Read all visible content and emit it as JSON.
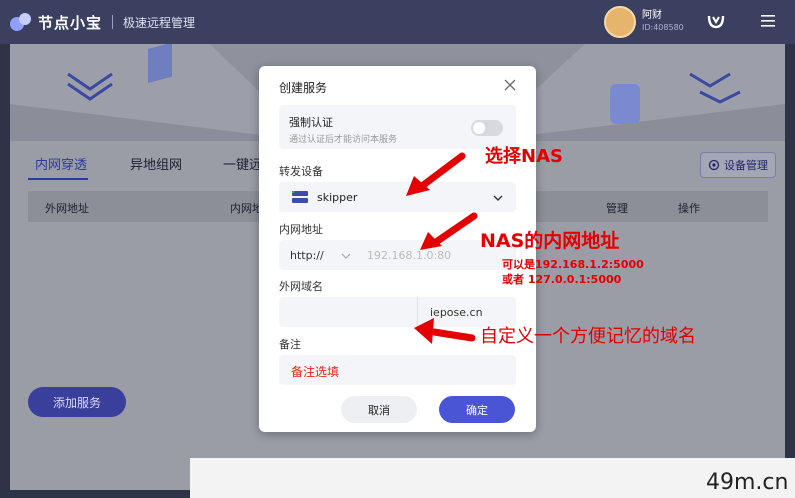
{
  "header": {
    "app_name": "节点小宝",
    "subtitle": "极速远程管理",
    "user_name": "阿财",
    "user_id": "ID:408580"
  },
  "main": {
    "tabs": [
      {
        "label": "内网穿透",
        "active": true
      },
      {
        "label": "异地组网",
        "active": false
      },
      {
        "label": "一键远"
      }
    ],
    "device_manage_label": "设备管理",
    "table_headers": [
      "外网地址",
      "内网地",
      "管理",
      "操作"
    ],
    "add_service_label": "添加服务"
  },
  "modal": {
    "title": "创建服务",
    "force_auth": {
      "title": "强制认证",
      "desc": "通过认证后才能访问本服务",
      "enabled": false
    },
    "forward_device": {
      "label": "转发设备",
      "value": "skipper"
    },
    "lan_address": {
      "label": "内网地址",
      "protocol": "http://",
      "placeholder": "192.168.1.0:80"
    },
    "wan_domain": {
      "label": "外网域名",
      "value": "",
      "suffix": "iepose.cn"
    },
    "note": {
      "label": "备注",
      "value": "备注选填"
    },
    "cancel_label": "取消",
    "confirm_label": "确定"
  },
  "annotations": {
    "select_nas": "选择NAS",
    "nas_lan": "NAS的内网地址",
    "nas_lan_example1": "可以是192.168.1.2:5000",
    "nas_lan_example2": "或者 127.0.0.1:5000",
    "custom_domain": "自定义一个方便记忆的域名",
    "color": "#e40000"
  },
  "watermark": {
    "text": "49m.cn"
  },
  "colors": {
    "accent": "#4a55d6",
    "header_bg": "#3b4060"
  }
}
